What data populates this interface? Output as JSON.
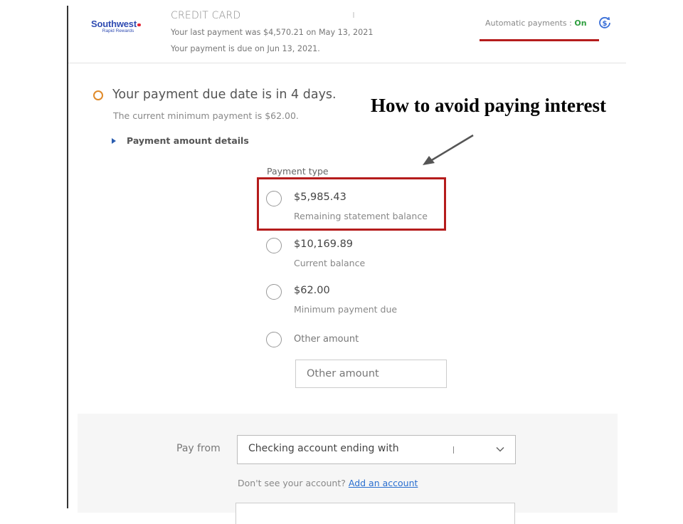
{
  "header": {
    "logo": {
      "brand": "Southwest",
      "sub": "Rapid Rewards"
    },
    "card_title": "CREDIT CARD",
    "last_payment": "Your last payment was $4,570.21 on May 13, 2021",
    "due_date": "Your payment is due on Jun 13, 2021.",
    "autopay_label": "Automatic payments : ",
    "autopay_status": "On",
    "autopay_icon": "refresh-dollar-icon",
    "colors": {
      "brand": "#304cb2",
      "status_on": "#2e9e3f",
      "highlight": "#b51c1c"
    }
  },
  "alert": {
    "icon": "circle-outline-icon",
    "title": "Your payment due date is in 4 days.",
    "subtitle": "The current minimum payment is $62.00.",
    "details_toggle": "Payment amount details"
  },
  "annotation": {
    "text": "How to avoid paying interest"
  },
  "payment_type": {
    "label": "Payment type",
    "options": [
      {
        "amount": "$5,985.43",
        "description": "Remaining statement balance",
        "selected": false,
        "highlighted": true
      },
      {
        "amount": "$10,169.89",
        "description": "Current balance",
        "selected": false
      },
      {
        "amount": "$62.00",
        "description": "Minimum payment due",
        "selected": false
      },
      {
        "label": "Other amount",
        "selected": false
      }
    ],
    "other_input_placeholder": "Other amount"
  },
  "pay_from": {
    "label": "Pay from",
    "selected": "Checking account ending with",
    "no_account_text": "Don't see your account? ",
    "add_account_link": "Add an account"
  }
}
